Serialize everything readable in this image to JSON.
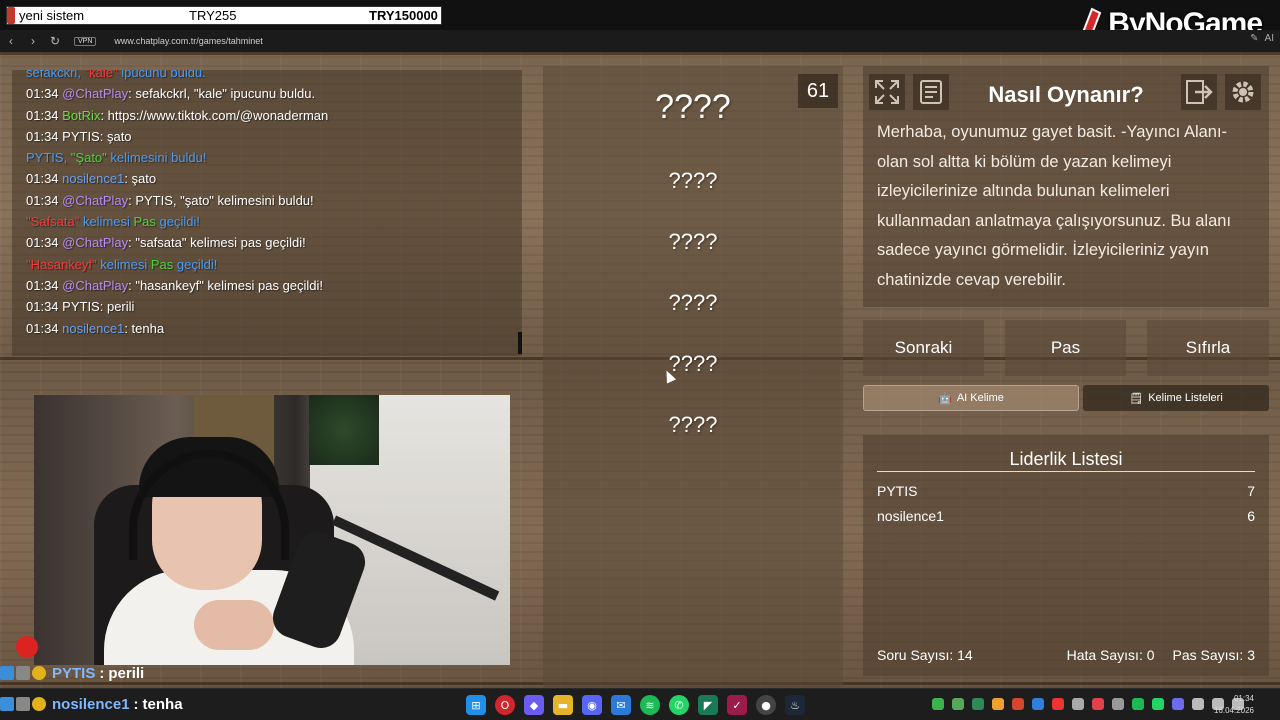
{
  "overlay": {
    "donation_name": "yeni sistem",
    "donation_amount": "TRY255",
    "donation_goal": "TRY150000",
    "logo_text": "ByNoGame"
  },
  "browser": {
    "vpn": "VPN",
    "url": "www.chatplay.com.tr/games/tahminet",
    "ai_label": "AI"
  },
  "chat": [
    [
      {
        "t": "sefakckrl, ",
        "c": "c-sys"
      },
      {
        "t": "\"kale\"",
        "c": "c-red"
      },
      {
        "t": " ipucunu buldu.",
        "c": "c-sys"
      }
    ],
    [
      {
        "t": "01:34 ",
        "c": "c-time"
      },
      {
        "t": "@ChatPlay",
        "c": "c-purple"
      },
      {
        "t": ": sefakckrl, \"kale\" ipucunu buldu.",
        "c": "c-time"
      }
    ],
    [
      {
        "t": "01:34 ",
        "c": "c-time"
      },
      {
        "t": "BotRix",
        "c": "c-green"
      },
      {
        "t": ": https://www.tiktok.com/@wonaderman",
        "c": "c-time"
      }
    ],
    [
      {
        "t": "01:34 ",
        "c": "c-time"
      },
      {
        "t": "PYTIS",
        "c": "c-time"
      },
      {
        "t": ": şato",
        "c": "c-time"
      }
    ],
    [
      {
        "t": "PYTIS, ",
        "c": "c-sys"
      },
      {
        "t": "\"Şato\"",
        "c": "c-pas"
      },
      {
        "t": " kelimesini buldu!",
        "c": "c-sys"
      }
    ],
    [
      {
        "t": "01:34 ",
        "c": "c-time"
      },
      {
        "t": "nosilence1",
        "c": "c-blue"
      },
      {
        "t": ": şato",
        "c": "c-time"
      }
    ],
    [
      {
        "t": "01:34 ",
        "c": "c-time"
      },
      {
        "t": "@ChatPlay",
        "c": "c-purple"
      },
      {
        "t": ": PYTIS, \"şato\" kelimesini buldu!",
        "c": "c-time"
      }
    ],
    [
      {
        "t": "\"Safsata\"",
        "c": "c-red"
      },
      {
        "t": " kelimesi ",
        "c": "c-sys"
      },
      {
        "t": "Pas",
        "c": "c-pas"
      },
      {
        "t": " geçildi!",
        "c": "c-sys"
      }
    ],
    [
      {
        "t": "01:34 ",
        "c": "c-time"
      },
      {
        "t": "@ChatPlay",
        "c": "c-purple"
      },
      {
        "t": ": \"safsata\" kelimesi pas geçildi!",
        "c": "c-time"
      }
    ],
    [
      {
        "t": "\"Hasankeyf\"",
        "c": "c-red"
      },
      {
        "t": " kelimesi ",
        "c": "c-sys"
      },
      {
        "t": "Pas",
        "c": "c-pas"
      },
      {
        "t": " geçildi!",
        "c": "c-sys"
      }
    ],
    [
      {
        "t": "01:34 ",
        "c": "c-time"
      },
      {
        "t": "@ChatPlay",
        "c": "c-purple"
      },
      {
        "t": ": \"hasankeyf\" kelimesi pas geçildi!",
        "c": "c-time"
      }
    ],
    [
      {
        "t": "01:34 ",
        "c": "c-time"
      },
      {
        "t": "PYTIS",
        "c": "c-time"
      },
      {
        "t": ": perili",
        "c": "c-time"
      }
    ],
    [
      {
        "t": "01:34 ",
        "c": "c-time"
      },
      {
        "t": "nosilence1",
        "c": "c-blue"
      },
      {
        "t": ": tenha",
        "c": "c-time"
      }
    ]
  ],
  "game": {
    "timer": "61",
    "words": [
      "????",
      "????",
      "????",
      "????",
      "????",
      "????"
    ]
  },
  "howto": {
    "title": "Nasıl Oynanır?",
    "text": "Merhaba, oyunumuz gayet basit. -Yayıncı Alanı- olan sol altta ki bölüm de yazan kelimeyi izleyicilerinize altında bulunan kelimeleri kullanmadan anlatmaya çalışıyorsunuz. Bu alanı sadece yayıncı görmelidir. İzleyicileriniz yayın chatinizde cevap verebilir."
  },
  "buttons": {
    "next": "Sonraki",
    "pass": "Pas",
    "reset": "Sıfırla",
    "ai_word": "AI Kelime",
    "word_lists": "Kelime Listeleri"
  },
  "leaderboard": {
    "title": "Liderlik Listesi",
    "rows": [
      {
        "name": "PYTIS",
        "score": "7"
      },
      {
        "name": "nosilence1",
        "score": "6"
      }
    ],
    "question_count": "Soru Sayısı: 14",
    "error_count": "Hata Sayısı: 0",
    "pass_count": "Pas Sayısı: 3"
  },
  "overlay_chat": [
    {
      "user": "PYTIS",
      "sep": ":",
      "msg": "perili"
    },
    {
      "user": "nosilence1",
      "sep": ":",
      "msg": "tenha"
    }
  ],
  "taskbar": {
    "time": "01:34",
    "date": "16.04.2026"
  },
  "colors": {
    "chat_purple": "#b98cf2",
    "chat_green": "#66dd44",
    "chat_red": "#f03b3b",
    "chat_system_blue": "#4a9cf5"
  }
}
